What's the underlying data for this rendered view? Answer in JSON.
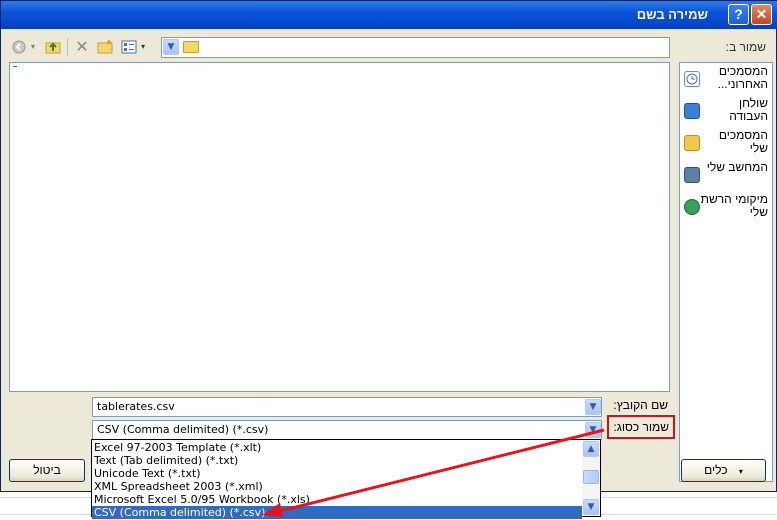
{
  "title": "שמירה בשם",
  "title_buttons": {
    "help": "?",
    "close": "✕"
  },
  "save_in_label": "שמור ב:",
  "toolbar_icons": [
    "back-icon",
    "up-folder-icon",
    "delete-icon",
    "new-folder-icon",
    "views-icon"
  ],
  "places": [
    {
      "label": "המסמכים האחרוני...",
      "icon": "recent-documents-icon",
      "color": "#6a8fc8"
    },
    {
      "label": "שולחן העבודה",
      "icon": "desktop-icon",
      "color": "#3b7fd6"
    },
    {
      "label": "המסמכים שלי",
      "icon": "my-documents-icon",
      "color": "#f2c94c"
    },
    {
      "label": "המחשב שלי",
      "icon": "my-computer-icon",
      "color": "#5c7fa3"
    },
    {
      "label": "מיקומי הרשת שלי",
      "icon": "network-places-icon",
      "color": "#3aa05a"
    }
  ],
  "filename_label": "שם הקובץ:",
  "filename_value": "tablerates.csv",
  "savetype_label": "שמור כסוג:",
  "savetype_value": "CSV (Comma delimited) (*.csv)",
  "dropdown_options": [
    "Excel 97-2003 Template (*.xlt)",
    "Text (Tab delimited) (*.txt)",
    "Unicode Text (*.txt)",
    "XML Spreadsheet 2003 (*.xml)",
    "Microsoft Excel 5.0/95 Workbook (*.xls)",
    "CSV (Comma delimited) (*.csv)"
  ],
  "tools_button": "כלים",
  "cancel_button": "ביטול",
  "colors": {
    "annotation": "#e8141c",
    "title_bar": "#0a55d8",
    "selection": "#316ac5"
  }
}
